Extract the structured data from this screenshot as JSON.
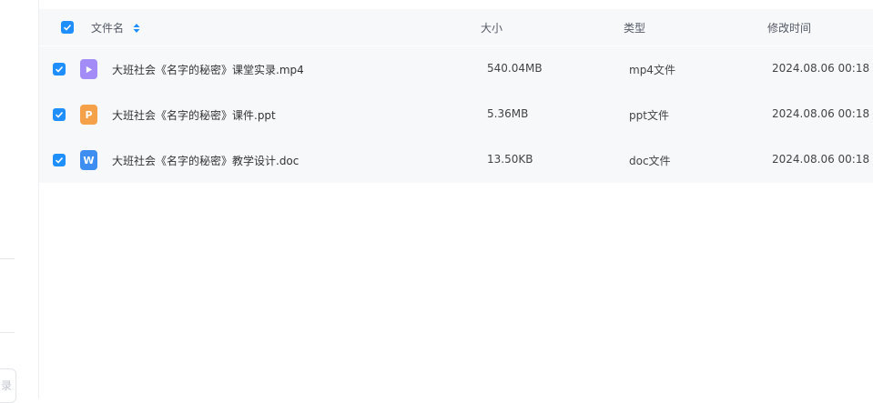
{
  "left_panel": {
    "clipped_label": "",
    "clipped_button_label": "录"
  },
  "table": {
    "columns": {
      "name": "文件名",
      "size": "大小",
      "type": "类型",
      "modified": "修改时间"
    },
    "rows": [
      {
        "checked": true,
        "icon": "video-file-icon",
        "name": "大班社会《名字的秘密》课堂实录.mp4",
        "size": "540.04MB",
        "type": "mp4文件",
        "modified": "2024.08.06 00:18"
      },
      {
        "checked": true,
        "icon": "ppt-file-icon",
        "icon_glyph": "P",
        "name": "大班社会《名字的秘密》课件.ppt",
        "size": "5.36MB",
        "type": "ppt文件",
        "modified": "2024.08.06 00:18"
      },
      {
        "checked": true,
        "icon": "word-file-icon",
        "icon_glyph": "W",
        "name": "大班社会《名字的秘密》教学设计.doc",
        "size": "13.50KB",
        "type": "doc文件",
        "modified": "2024.08.06 00:18"
      }
    ]
  },
  "colors": {
    "accent": "#1f8fff",
    "row_background": "#f7f8fa",
    "video_icon": "#a38cf7",
    "ppt_icon": "#f5a14a",
    "doc_icon": "#3d8ef0"
  }
}
